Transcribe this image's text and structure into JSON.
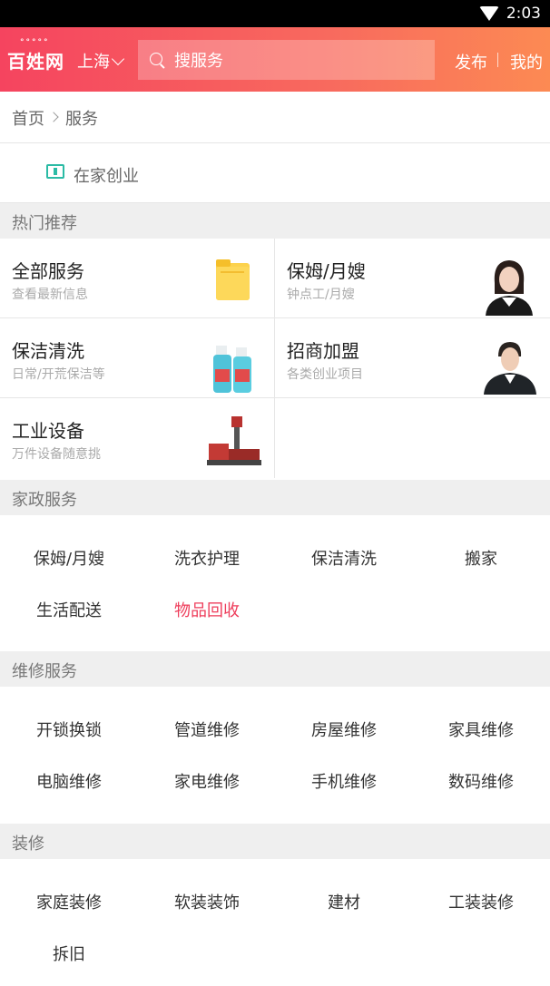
{
  "status": {
    "time": "2:03"
  },
  "header": {
    "logo": "百姓网",
    "city": "上海",
    "search_placeholder": "搜服务",
    "publish": "发布",
    "mine": "我的"
  },
  "breadcrumb": {
    "home": "首页",
    "current": "服务"
  },
  "startup": {
    "label": "在家创业"
  },
  "hot": {
    "title": "热门推荐",
    "cards": [
      {
        "title": "全部服务",
        "sub": "查看最新信息"
      },
      {
        "title": "保姆/月嫂",
        "sub": "钟点工/月嫂"
      },
      {
        "title": "保洁清洗",
        "sub": "日常/开荒保洁等"
      },
      {
        "title": "招商加盟",
        "sub": "各类创业项目"
      },
      {
        "title": "工业设备",
        "sub": "万件设备随意挑"
      }
    ]
  },
  "housekeeping": {
    "title": "家政服务",
    "items": [
      "保姆/月嫂",
      "洗衣护理",
      "保洁清洗",
      "搬家",
      "生活配送",
      "物品回收"
    ]
  },
  "repair": {
    "title": "维修服务",
    "items": [
      "开锁换锁",
      "管道维修",
      "房屋维修",
      "家具维修",
      "电脑维修",
      "家电维修",
      "手机维修",
      "数码维修"
    ]
  },
  "decor": {
    "title": "装修",
    "items": [
      "家庭装修",
      "软装装饰",
      "建材",
      "工装装修",
      "拆旧"
    ]
  },
  "colors": {
    "brand_start": "#f5445f",
    "brand_end": "#fc8a53",
    "accent_red": "#ee3d5b",
    "icon_teal": "#2bbba5"
  }
}
